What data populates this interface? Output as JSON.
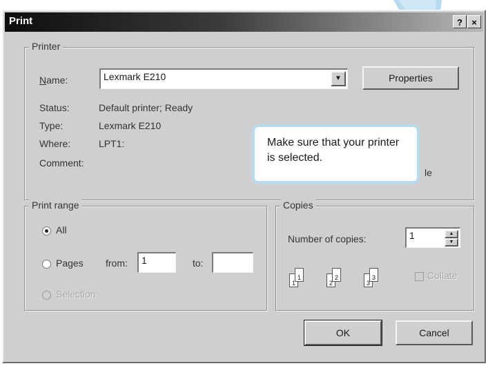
{
  "dialog": {
    "title": "Print",
    "help_glyph": "?",
    "close_glyph": "×"
  },
  "printer_group": {
    "legend": "Printer",
    "name_label": "Name:",
    "name_value": "Lexmark E210",
    "properties_label": "Properties",
    "status_label": "Status:",
    "status_value": "Default printer; Ready",
    "type_label": "Type:",
    "type_value": "Lexmark E210",
    "where_label": "Where:",
    "where_value": "LPT1:",
    "comment_label": "Comment:",
    "print_to_file_partial": "le"
  },
  "print_range": {
    "legend": "Print range",
    "all_label": "All",
    "pages_label": "Pages",
    "from_label": "from:",
    "from_value": "1",
    "to_label": "to:",
    "to_value": "",
    "selection_label": "Selection"
  },
  "copies": {
    "legend": "Copies",
    "number_label": "Number of copies:",
    "number_value": "1",
    "collate_label": "Collate"
  },
  "footer": {
    "ok_label": "OK",
    "cancel_label": "Cancel"
  },
  "callout": {
    "text": "Make sure that your printer is selected.",
    "color": "#b5dcf0"
  }
}
